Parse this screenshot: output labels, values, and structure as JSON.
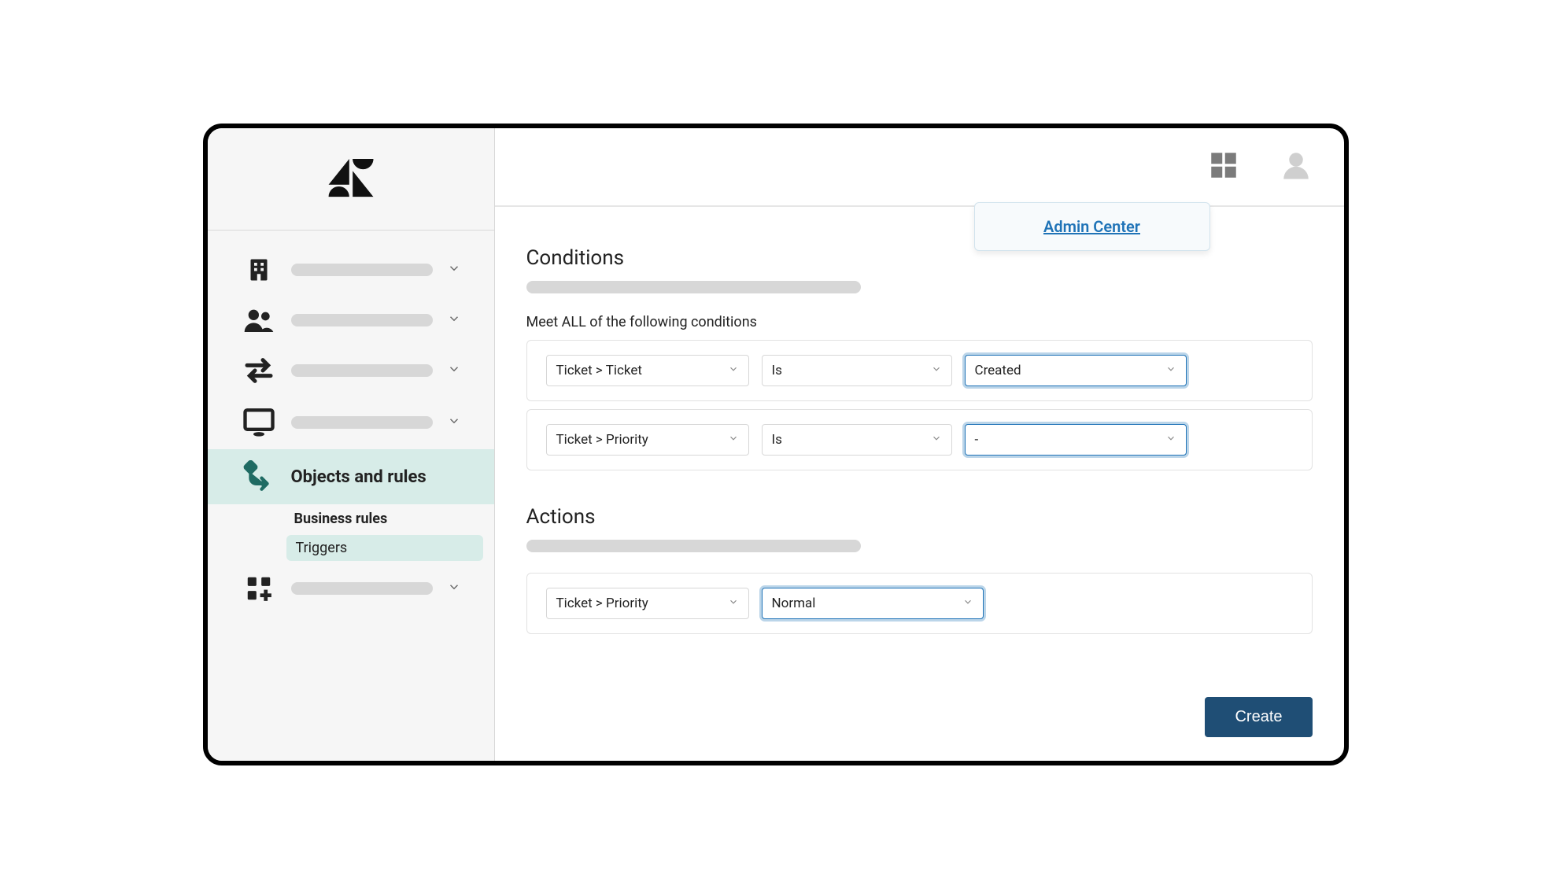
{
  "popover": {
    "link_label": "Admin Center"
  },
  "sidebar": {
    "active_label": "Objects and rules",
    "sub_items": {
      "business_rules": "Business rules",
      "triggers": "Triggers"
    }
  },
  "conditions": {
    "title": "Conditions",
    "meet_all_label": "Meet ALL of the following conditions",
    "rows": [
      {
        "field": "Ticket > Ticket",
        "operator": "Is",
        "value": "Created"
      },
      {
        "field": "Ticket > Priority",
        "operator": "Is",
        "value": "-"
      }
    ]
  },
  "actions": {
    "title": "Actions",
    "rows": [
      {
        "field": "Ticket > Priority",
        "value": "Normal"
      }
    ]
  },
  "footer": {
    "create_label": "Create"
  },
  "colors": {
    "accent_teal": "#d7ece8",
    "link_blue": "#1f73b7",
    "primary_button": "#1f4e75"
  }
}
